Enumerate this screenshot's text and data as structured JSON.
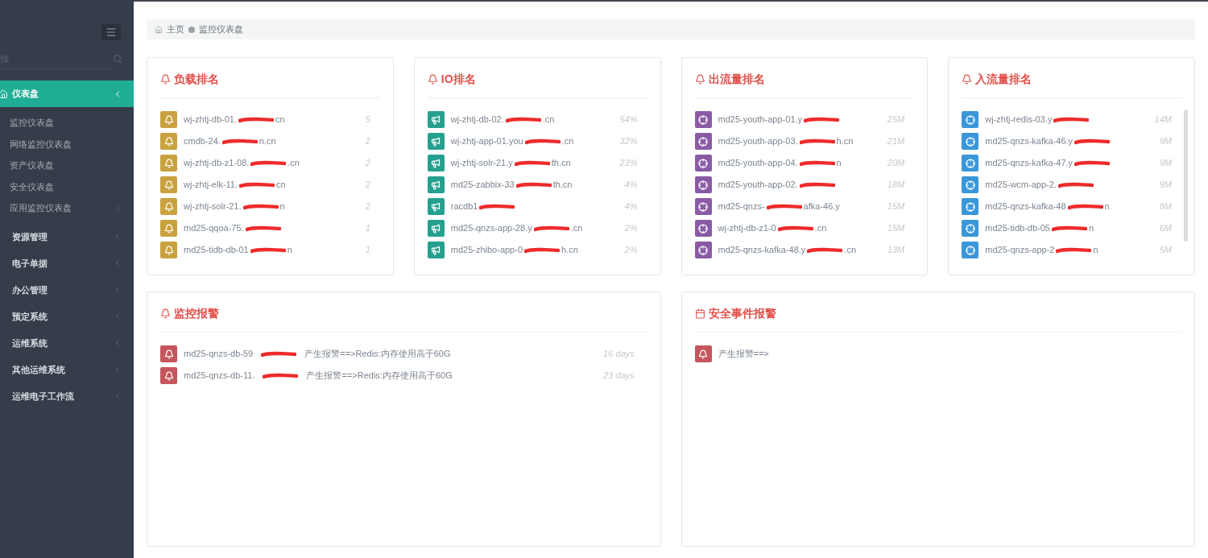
{
  "sidebar": {
    "search": {
      "placeholder": "找"
    },
    "items": [
      {
        "label": "仪表盘",
        "selected": true,
        "expanded": true,
        "children": [
          {
            "label": "监控仪表盘",
            "has_submenu": false
          },
          {
            "label": "网络监控仪表盘",
            "has_submenu": false
          },
          {
            "label": "资产仪表盘",
            "has_submenu": false
          },
          {
            "label": "安全仪表盘",
            "has_submenu": false
          },
          {
            "label": "应用监控仪表盘",
            "has_submenu": true
          }
        ]
      },
      {
        "label": "资源管理",
        "selected": false,
        "expanded": false
      },
      {
        "label": "电子单据",
        "selected": false,
        "expanded": false
      },
      {
        "label": "办公管理",
        "selected": false,
        "expanded": false
      },
      {
        "label": "预定系统",
        "selected": false,
        "expanded": false
      },
      {
        "label": "运维系统",
        "selected": false,
        "expanded": false
      },
      {
        "label": "其他运维系统",
        "selected": false,
        "expanded": false
      },
      {
        "label": "运维电子工作流",
        "selected": false,
        "expanded": false
      }
    ]
  },
  "breadcrumb": [
    "主页",
    "监控仪表盘"
  ],
  "rank_panels": [
    {
      "title": "负载排名",
      "color": "#c9a23f",
      "rows": [
        {
          "host": "wj-zhtj-db-01.",
          "tail": "cn",
          "value": "5"
        },
        {
          "host": "cmdb-24.",
          "tail": "n.cn",
          "value": "2"
        },
        {
          "host": "wj-zhtj-db-z1-08.",
          "tail": ".cn",
          "value": "2"
        },
        {
          "host": "wj-zhtj-elk-11.",
          "tail": "cn",
          "value": "2"
        },
        {
          "host": "wj-zhtj-solr-21.",
          "tail": "n",
          "value": "2"
        },
        {
          "host": "md25-qqoa-75.",
          "value": "1"
        },
        {
          "host": "md25-tidb-db-01",
          "tail": "n",
          "value": "1"
        }
      ]
    },
    {
      "title": "IO排名",
      "color": "#25a08f",
      "rows": [
        {
          "host": "wj-zhtj-db-02.",
          "tail": ".cn",
          "value": "54%"
        },
        {
          "host": "wj-zhtj-app-01.you",
          "tail": ".cn",
          "value": "32%"
        },
        {
          "host": "wj-zhtj-solr-21.y",
          "tail": "th.cn",
          "value": "23%"
        },
        {
          "host": "md25-zabbix-33",
          "tail": "th.cn",
          "value": "4%"
        },
        {
          "host": "racdb1",
          "value": "4%"
        },
        {
          "host": "md25-qnzs-app-28.y",
          "tail": ".cn",
          "value": "2%"
        },
        {
          "host": "md25-zhibo-app-0",
          "tail": "h.cn",
          "value": "2%"
        }
      ]
    },
    {
      "title": "出流量排名",
      "color": "#8a5ba5",
      "rows": [
        {
          "host": "md25-youth-app-01.y",
          "value": "25M"
        },
        {
          "host": "md25-youth-app-03.",
          "tail": "h.cn",
          "value": "21M"
        },
        {
          "host": "md25-youth-app-04.",
          "tail": "n",
          "value": "20M"
        },
        {
          "host": "md25-youth-app-02.",
          "value": "18M"
        },
        {
          "host": "md25-qnzs-",
          "tail": "afka-46.y",
          "value": "15M"
        },
        {
          "host": "wj-zhtj-db-z1-0",
          "tail": ".cn",
          "value": "15M"
        },
        {
          "host": "md25-qnzs-kafka-48.y",
          "tail": ".cn",
          "value": "13M"
        }
      ]
    },
    {
      "title": "入流量排名",
      "color": "#3a97d9",
      "rows": [
        {
          "host": "wj-zhtj-redis-03.y",
          "value": "14M"
        },
        {
          "host": "md25-qnzs-kafka-46.y",
          "value": "9M"
        },
        {
          "host": "md25-qnzs-kafka-47.y",
          "value": "9M"
        },
        {
          "host": "md25-wcm-app-2.",
          "value": "9M"
        },
        {
          "host": "md25-qnzs-kafka-48",
          "tail": "n",
          "value": "8M"
        },
        {
          "host": "md25-tidb-db-05",
          "tail": "n",
          "value": "6M"
        },
        {
          "host": "md25-qnzs-app-2",
          "tail": "n",
          "value": "5M"
        }
      ]
    }
  ],
  "alert_panels": [
    {
      "title": "监控报警",
      "color": "#c5565b",
      "rows": [
        {
          "host": "md25-qnzs-db-59",
          "message": "产生报警==>Redis:内存使用高于60G",
          "time": "16 days"
        },
        {
          "host": "md25-qnzs-db-11.",
          "message": "产生报警==>Redis:内存使用高于60G",
          "time": "23 days"
        }
      ]
    },
    {
      "title": "安全事件报警",
      "color": "#c5565b",
      "rows": [
        {
          "message": "产生报警==>"
        }
      ]
    }
  ]
}
